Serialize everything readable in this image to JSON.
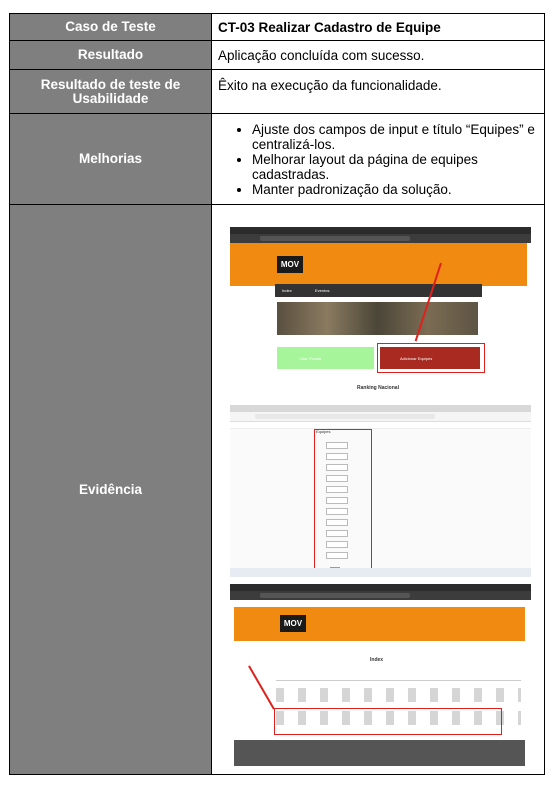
{
  "rows": {
    "test_case": {
      "label": "Caso de Teste",
      "value": "CT-03 Realizar Cadastro de Equipe"
    },
    "result": {
      "label": "Resultado",
      "value": "Aplicação concluída com sucesso."
    },
    "usability": {
      "label": "Resultado de teste de Usabilidade",
      "value": "Êxito na execução da funcionalidade."
    },
    "improvements": {
      "label": "Melhorias",
      "items": [
        "Ajuste dos campos de input e título “Equipes” e centralizá-los.",
        "Melhorar layout da página de equipes cadastradas.",
        "Manter padronização da solução."
      ]
    },
    "evidence": {
      "label": "Evidência"
    }
  },
  "screenshots": {
    "logo_text": "MOV",
    "shot1": {
      "nav_left": "Index",
      "nav_right": "Eventos",
      "button_create": "Criar Evento",
      "button_add": "Adicionar Equipes",
      "ranking": "Ranking Nacional"
    },
    "shot2": {
      "form_title": "Equipes"
    },
    "shot3": {
      "heading": "Index"
    }
  },
  "colors": {
    "header_gray": "#7f7f7f",
    "brand_orange": "#f08a10",
    "highlight_red": "#e0201c"
  }
}
